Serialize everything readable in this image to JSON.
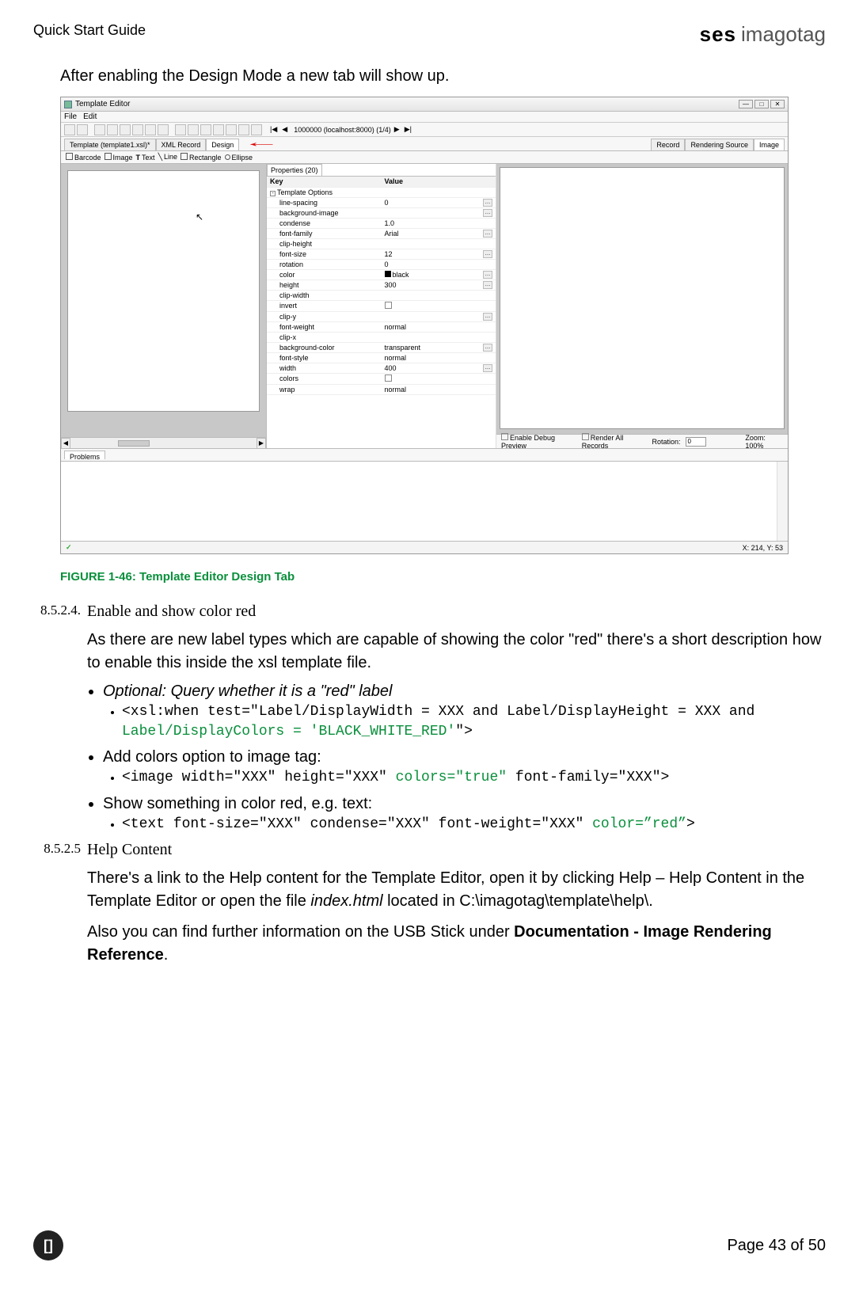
{
  "header": {
    "doc_title": "Quick Start Guide",
    "logo_bold": "ses",
    "logo_light": "imagotag"
  },
  "intro_text": "After enabling the Design Mode a new tab will show up.",
  "screenshot": {
    "window_title": "Template Editor",
    "menu": [
      "File",
      "Edit"
    ],
    "toolbar_text": "1000000 (localhost:8000) (1/4)",
    "tabs_left": [
      "Template (template1.xsl)*",
      "XML Record",
      "Design"
    ],
    "tabs_right": [
      "Record",
      "Rendering Source",
      "Image"
    ],
    "palette": [
      "Barcode",
      "Image",
      "Text",
      "Line",
      "Rectangle",
      "Ellipse"
    ],
    "props_tab": "Properties (20)",
    "props_header_key": "Key",
    "props_header_value": "Value",
    "props_section": "Template Options",
    "props_rows": [
      {
        "k": "line-spacing",
        "v": "0",
        "btn": true
      },
      {
        "k": "background-image",
        "v": "",
        "btn": true
      },
      {
        "k": "condense",
        "v": "1.0",
        "btn": false
      },
      {
        "k": "font-family",
        "v": "Arial",
        "btn": true
      },
      {
        "k": "clip-height",
        "v": "",
        "btn": false
      },
      {
        "k": "font-size",
        "v": "12",
        "btn": true
      },
      {
        "k": "rotation",
        "v": "0",
        "btn": false
      },
      {
        "k": "color",
        "v": "black",
        "btn": true,
        "swatch": true
      },
      {
        "k": "height",
        "v": "300",
        "btn": true
      },
      {
        "k": "clip-width",
        "v": "",
        "btn": false
      },
      {
        "k": "invert",
        "v": "",
        "btn": false,
        "chk": true
      },
      {
        "k": "clip-y",
        "v": "",
        "btn": true
      },
      {
        "k": "font-weight",
        "v": "normal",
        "btn": false
      },
      {
        "k": "clip-x",
        "v": "",
        "btn": false
      },
      {
        "k": "background-color",
        "v": "transparent",
        "btn": true
      },
      {
        "k": "font-style",
        "v": "normal",
        "btn": false
      },
      {
        "k": "width",
        "v": "400",
        "btn": true
      },
      {
        "k": "colors",
        "v": "",
        "btn": false,
        "chk": true
      },
      {
        "k": "wrap",
        "v": "normal",
        "btn": false
      }
    ],
    "bottom_opts": {
      "debug": "Enable Debug Preview",
      "renderall": "Render All Records",
      "rotation_label": "Rotation:",
      "rotation_value": "0",
      "zoom": "Zoom: 100%"
    },
    "problems_tab": "Problems",
    "status_coords": "X: 214, Y: 53"
  },
  "figure_caption": "FIGURE 1-46: Template Editor Design Tab",
  "section_8524": {
    "num": "8.5.2.4.",
    "title": "Enable and show color red"
  },
  "para_8524": "As there are new label types which are capable of showing the color \"red\" there's a short description how to enable this inside the xsl template file.",
  "bullets": {
    "b1": "Optional: Query whether it is a \"red\" label",
    "b1_code_a": "<xsl:when test=\"Label/DisplayWidth = XXX and Label/DisplayHeight = XXX and ",
    "b1_code_green": "Label/DisplayColors = 'BLACK_WHITE_RED'",
    "b1_code_b": "\">",
    "b2": "Add colors option to image tag:",
    "b2_code_a": "<image width=\"XXX\" height=\"XXX\" ",
    "b2_code_green": "colors=\"true\"",
    "b2_code_b": " font-family=\"XXX\">",
    "b3": "Show something in color red, e.g. text:",
    "b3_code_a": "<text font-size=\"XXX\" condense=\"XXX\" font-weight=\"XXX\" ",
    "b3_code_green": "color=”red”",
    "b3_code_b": ">"
  },
  "section_8525": {
    "num": "8.5.2.5",
    "title": "Help Content"
  },
  "para_8525_a": "There's a link to the Help content for the Template Editor, open it by clicking Help – Help Content in the Template Editor or open the file ",
  "para_8525_italic": "index.html",
  "para_8525_b": " located in C:\\imagotag\\template\\help\\.",
  "para_8525_2a": "Also you can find further information on the USB Stick under ",
  "para_8525_2b": "Documentation - Image Rendering Reference",
  "para_8525_2c": ".",
  "footer": {
    "icon": "[]",
    "page": "Page 43 of 50"
  }
}
